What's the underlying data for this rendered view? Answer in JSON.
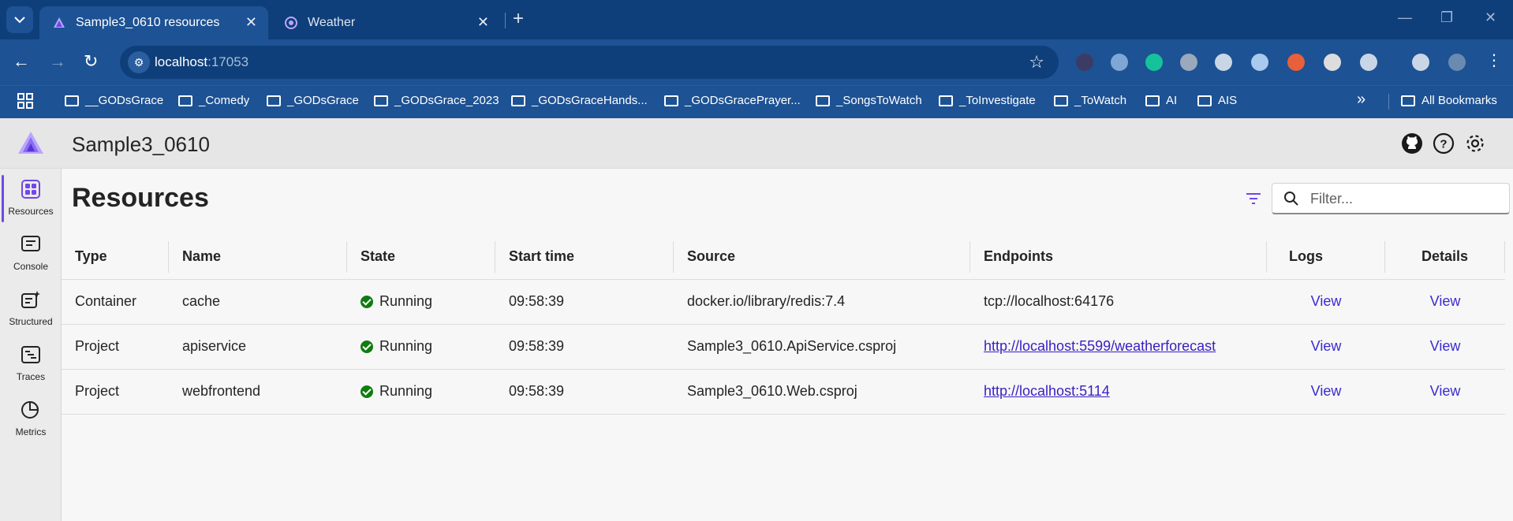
{
  "browser": {
    "tabs": [
      {
        "title": "Sample3_0610 resources",
        "active": true
      },
      {
        "title": "Weather",
        "active": false
      }
    ],
    "address": {
      "host": "localhost",
      "port": ":17053"
    },
    "bookmarks": [
      "__GODsGrace",
      "_Comedy",
      "_GODsGrace",
      "_GODsGrace_2023",
      "_GODsGraceHands...",
      "_GODsGracePrayer...",
      "_SongsToWatch",
      "_ToInvestigate",
      "_ToWatch",
      "AI",
      "AIS"
    ],
    "all_bookmarks": "All Bookmarks",
    "overflow": "»"
  },
  "app": {
    "title": "Sample3_0610",
    "page_title": "Resources",
    "filter_placeholder": "Filter...",
    "accent_color": "#7048e8",
    "nav": [
      {
        "label": "Resources",
        "icon": "resources-icon",
        "active": true
      },
      {
        "label": "Console",
        "icon": "console-icon",
        "active": false
      },
      {
        "label": "Structured",
        "icon": "structured-icon",
        "active": false
      },
      {
        "label": "Traces",
        "icon": "traces-icon",
        "active": false
      },
      {
        "label": "Metrics",
        "icon": "metrics-icon",
        "active": false
      }
    ],
    "table": {
      "columns": [
        "Type",
        "Name",
        "State",
        "Start time",
        "Source",
        "Endpoints",
        "Logs",
        "Details"
      ],
      "rows": [
        {
          "type": "Container",
          "name": "cache",
          "state": "Running",
          "start": "09:58:39",
          "source": "docker.io/library/redis:7.4",
          "endpoint": "tcp://localhost:64176",
          "endpoint_link": false,
          "logs": "View",
          "details": "View"
        },
        {
          "type": "Project",
          "name": "apiservice",
          "state": "Running",
          "start": "09:58:39",
          "source": "Sample3_0610.ApiService.csproj",
          "endpoint": "http://localhost:5599/weatherforecast",
          "endpoint_link": true,
          "logs": "View",
          "details": "View"
        },
        {
          "type": "Project",
          "name": "webfrontend",
          "state": "Running",
          "start": "09:58:39",
          "source": "Sample3_0610.Web.csproj",
          "endpoint": "http://localhost:5114",
          "endpoint_link": true,
          "logs": "View",
          "details": "View"
        }
      ]
    }
  }
}
